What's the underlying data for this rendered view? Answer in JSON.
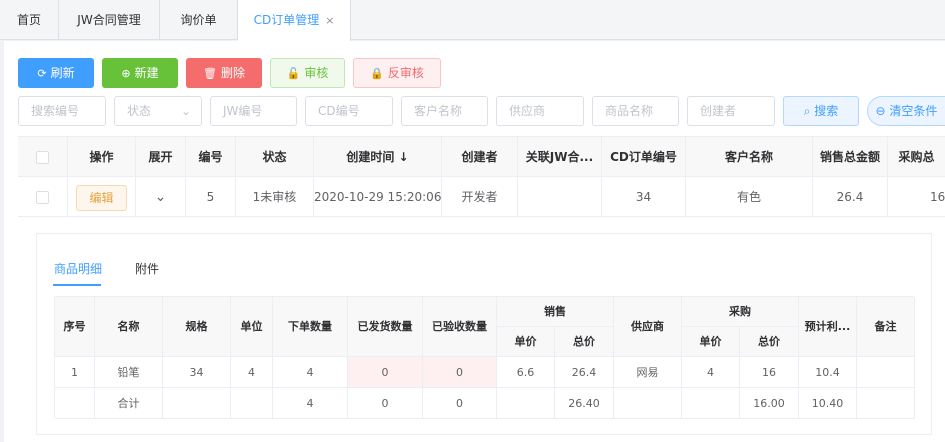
{
  "tabs": [
    {
      "label": "首页"
    },
    {
      "label": "JW合同管理"
    },
    {
      "label": "询价单"
    },
    {
      "label": "CD订单管理",
      "close": "×"
    }
  ],
  "toolbar": {
    "refresh": "刷新",
    "new": "新建",
    "delete": "删除",
    "approve": "审核",
    "unapprove": "反审核"
  },
  "filters": {
    "search_no": "搜索编号",
    "status": "状态",
    "jw_no": "JW编号",
    "cd_no": "CD编号",
    "customer": "客户名称",
    "supplier": "供应商",
    "product": "商品名称",
    "creator": "创建者",
    "search_btn": "搜索",
    "clear_btn": "清空条件"
  },
  "grid": {
    "headers": [
      "操作",
      "展开",
      "编号",
      "状态",
      "创建时间 ↓",
      "创建者",
      "关联JW合...",
      "CD订单编号",
      "客户名称",
      "销售总金额",
      "采购总"
    ],
    "row": {
      "action": "编辑",
      "id": "5",
      "status": "1未审核",
      "created": "2020-10-29 15:20:06",
      "creator": "开发者",
      "jw": "",
      "cd_no": "34",
      "customer": "有色",
      "sales_total": "26.4",
      "purchase_total": "16"
    }
  },
  "subtabs": {
    "detail": "商品明细",
    "attach": "附件"
  },
  "detail": {
    "headers": {
      "seq": "序号",
      "name": "名称",
      "spec": "规格",
      "unit": "单位",
      "qty": "下单数量",
      "shipped": "已发货数量",
      "checked": "已验收数量",
      "sales": "销售",
      "price": "单价",
      "total": "总价",
      "supplier": "供应商",
      "purchase": "采购",
      "p_price": "单价",
      "p_total": "总价",
      "profit": "预计利...",
      "remark": "备注"
    },
    "row": {
      "seq": "1",
      "name": "铅笔",
      "spec": "34",
      "unit": "4",
      "qty": "4",
      "shipped": "0",
      "checked": "0",
      "price": "6.6",
      "total": "26.4",
      "supplier": "网易",
      "p_price": "4",
      "p_total": "16",
      "profit": "10.4",
      "remark": ""
    },
    "sum": {
      "label": "合计",
      "qty": "4",
      "shipped": "0",
      "checked": "0",
      "total": "26.40",
      "p_total": "16.00",
      "profit": "10.40"
    }
  }
}
